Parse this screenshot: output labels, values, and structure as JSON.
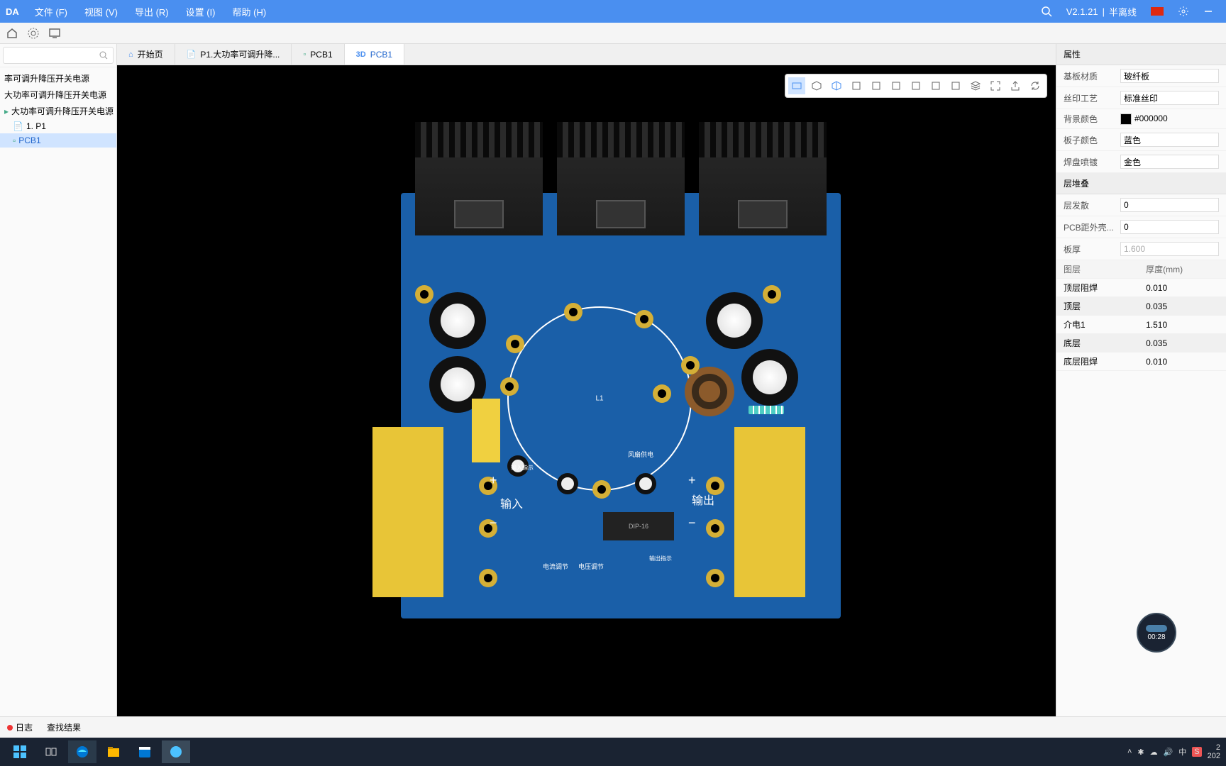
{
  "menubar": {
    "logo": "DA",
    "items": [
      "文件 (F)",
      "视图 (V)",
      "导出 (R)",
      "设置 (I)",
      "帮助 (H)"
    ],
    "version": "V2.1.21",
    "status": "半离线"
  },
  "tabs": [
    {
      "icon": "home",
      "label": "开始页",
      "active": false
    },
    {
      "icon": "doc",
      "label": "P1.大功率可调升降...",
      "active": false
    },
    {
      "icon": "pcb",
      "label": "PCB1",
      "active": false
    },
    {
      "icon": "3d",
      "label": "PCB1",
      "active": true
    }
  ],
  "tree": {
    "items": [
      {
        "label": "率可调升降压开关电源",
        "icon": "folder"
      },
      {
        "label": "大功率可调升降压开关电源",
        "icon": "folder"
      },
      {
        "label": "大功率可调升降压开关电源",
        "icon": "pcb"
      },
      {
        "label": "1. P1",
        "icon": "doc"
      },
      {
        "label": "PCB1",
        "icon": "pcb",
        "selected": true
      }
    ]
  },
  "properties": {
    "title": "属性",
    "rows": [
      {
        "label": "基板材质",
        "value": "玻纤板"
      },
      {
        "label": "丝印工艺",
        "value": "标准丝印"
      },
      {
        "label": "背景颜色",
        "value": "#000000",
        "color": "#000000"
      },
      {
        "label": "板子颜色",
        "value": "蓝色"
      },
      {
        "label": "焊盘喷镀",
        "value": "金色"
      }
    ]
  },
  "layers": {
    "title": "层堆叠",
    "rows": [
      {
        "label": "层发散",
        "value": "0"
      },
      {
        "label": "PCB距外壳...",
        "value": "0"
      },
      {
        "label": "板厚",
        "value": "1.600",
        "readonly": true
      }
    ],
    "table": {
      "headers": [
        "图层",
        "厚度(mm)"
      ],
      "rows": [
        [
          "顶层阻焊",
          "0.010"
        ],
        [
          "顶层",
          "0.035"
        ],
        [
          "介电1",
          "1.510"
        ],
        [
          "底层",
          "0.035"
        ],
        [
          "底层阻焊",
          "0.010"
        ]
      ]
    }
  },
  "silkscreen": {
    "input_label": "输入",
    "output_label": "输出",
    "ic_label": "DIP-16",
    "fan_label": "风扇供电",
    "input_ind": "输入指示",
    "output_ind": "输出指示",
    "current_adj": "电流调节",
    "voltage_adj": "电压调节"
  },
  "statusbar": {
    "log": "日志",
    "results": "查找结果"
  },
  "timer": "00:28",
  "tray": {
    "ime": "中",
    "year": "202"
  }
}
